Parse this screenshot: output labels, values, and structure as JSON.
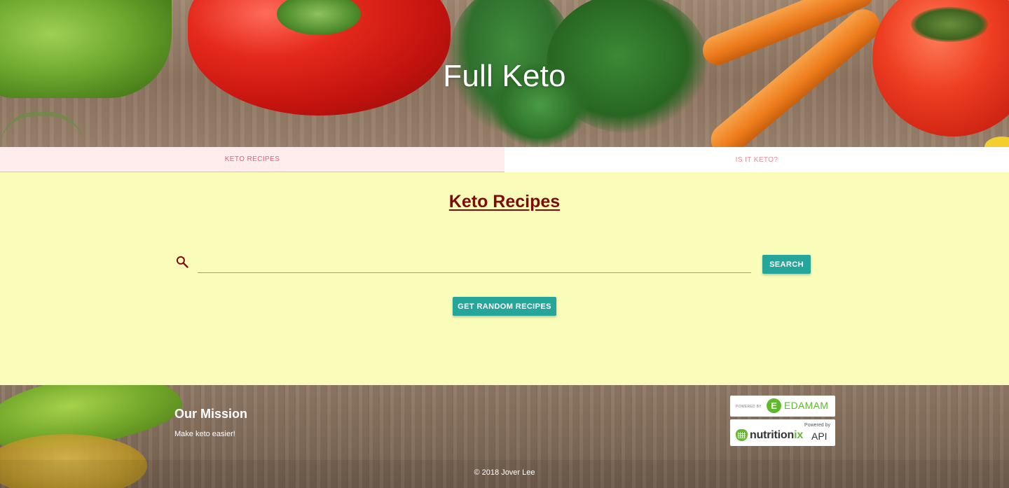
{
  "header": {
    "title": "Full Keto"
  },
  "tabs": [
    {
      "label": "Keto Recipes",
      "active": true
    },
    {
      "label": "Is it Keto?",
      "active": false
    }
  ],
  "main": {
    "heading": "Keto Recipes",
    "search": {
      "value": "",
      "placeholder": "",
      "icon": "search-icon",
      "button_label": "Search"
    },
    "random_button_label": "Get Random Recipes"
  },
  "footer": {
    "mission_title": "Our Mission",
    "mission_text": "Make keto easier!",
    "copyright": "© 2018 Jover Lee",
    "badges": {
      "edamam": {
        "small": "POWERED BY",
        "brand": "EDAMAM"
      },
      "nutritionix": {
        "small": "Powered by",
        "brand_main": "nutrition",
        "brand_suffix": "ix",
        "api": "API"
      }
    }
  },
  "colors": {
    "main_background": "#f9fdb9",
    "heading": "#7f0a0a",
    "button": "#26a69a",
    "active_tab_bg": "#ffeced",
    "tab_text": "#e2616f"
  }
}
